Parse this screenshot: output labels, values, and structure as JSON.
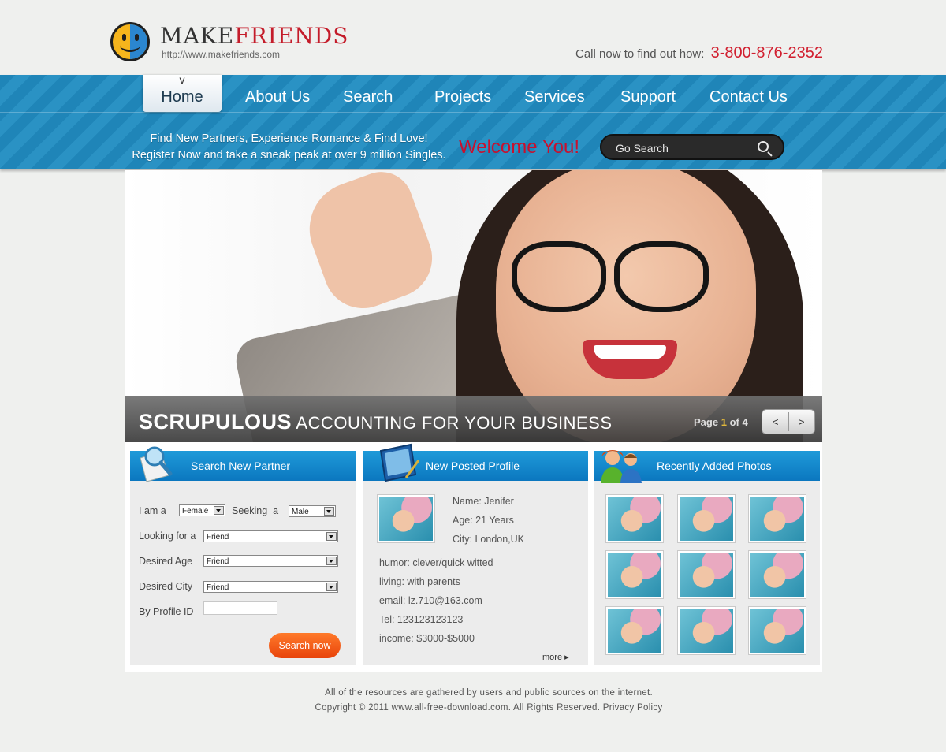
{
  "header": {
    "logo_make": "MAKE",
    "logo_friends": "FRIENDS",
    "logo_url": "http://www.makefriends.com",
    "call_text": "Call now to find out how:",
    "phone": "3-800-876-2352"
  },
  "nav": {
    "caret": "v",
    "items": [
      "Home",
      "About Us",
      "Search",
      "Projects",
      "Services",
      "Support",
      "Contact Us"
    ]
  },
  "band": {
    "tagline_1": "Find New Partners, Experience Romance & Find Love!",
    "tagline_2": "Register Now and take a sneak peak at over 9 million Singles.",
    "welcome": "Welcome You!",
    "search_placeholder": "Go Search"
  },
  "hero": {
    "caption_big": "SCRUPULOUS",
    "caption_rest": "ACCOUNTING FOR YOUR BUSINESS",
    "page_word": "Page",
    "page_current": "1",
    "page_of": "of 4",
    "prev": "<",
    "next": ">"
  },
  "search_box": {
    "title": "Search New Partner",
    "i_am_a": "I am a",
    "i_am_value": "Female",
    "seeking": "Seeking",
    "seeking_a": "a",
    "seeking_value": "Male",
    "looking_for": "Looking for a",
    "looking_value": "Friend",
    "desired_age": "Desired Age",
    "age_value": "Friend",
    "desired_city": "Desired City",
    "city_value": "Friend",
    "profile_id": "By Profile ID",
    "button": "Search now"
  },
  "profile_box": {
    "title": "New Posted Profile",
    "name": "Name: Jenifer",
    "age": "Age: 21 Years",
    "city": "City: London,UK",
    "humor": "humor:  clever/quick witted",
    "living": "living:    with parents",
    "email": "email:   lz.710@163.com",
    "tel": "Tel:      123123123123",
    "income": "income:   $3000-$5000",
    "more": "more ▸"
  },
  "photos_box": {
    "title": "Recently Added Photos",
    "count": 9
  },
  "footer": {
    "line1": "All of the resources are gathered by users and public sources on the internet.",
    "line2": "Copyright © 2011 www.all-free-download.com. All Rights Reserved. Privacy Policy"
  },
  "colors": {
    "nav_blue": "#1f85b8",
    "phone_red": "#d11f2f",
    "welcome_red": "#c8102e",
    "box_head_blue": "#0b77bf",
    "button_orange": "#e8430b"
  }
}
